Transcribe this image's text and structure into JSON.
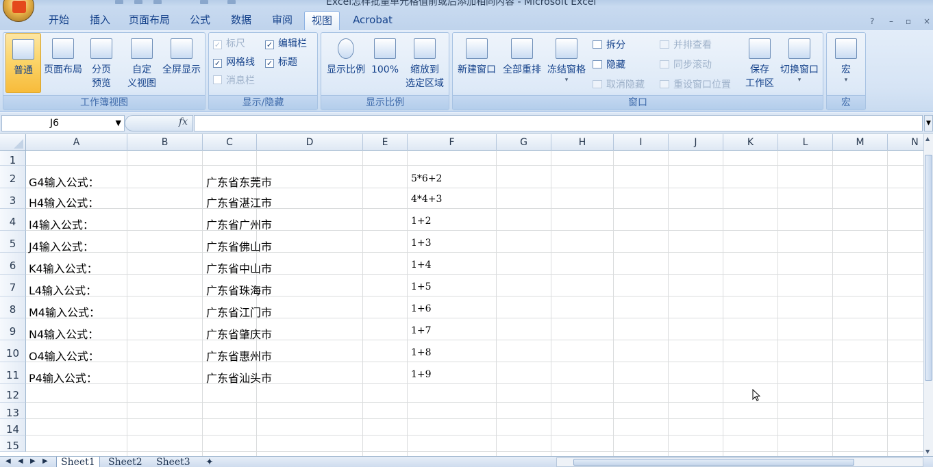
{
  "window": {
    "title": "Excel怎样批量单元格值前或后添加相同内容 - Microsoft Excel"
  },
  "tabs": [
    "开始",
    "插入",
    "页面布局",
    "公式",
    "数据",
    "审阅",
    "视图",
    "Acrobat"
  ],
  "active_tab": "视图",
  "ribbon": {
    "workbook_views": {
      "label": "工作簿视图",
      "normal": "普通",
      "page_layout": "页面布局",
      "page_break_1": "分页",
      "page_break_2": "预览",
      "custom_1": "自定",
      "custom_2": "义视图",
      "fullscreen": "全屏显示"
    },
    "show_hide": {
      "label": "显示/隐藏",
      "ruler": "标尺",
      "formula_bar": "编辑栏",
      "gridlines": "网格线",
      "headings": "标题",
      "message_bar": "消息栏"
    },
    "zoom": {
      "label": "显示比例",
      "zoom": "显示比例",
      "hundred": "100%",
      "zoom_sel_1": "缩放到",
      "zoom_sel_2": "选定区域"
    },
    "window": {
      "label": "窗口",
      "new_window": "新建窗口",
      "arrange_all": "全部重排",
      "freeze": "冻结窗格",
      "split": "拆分",
      "hide": "隐藏",
      "unhide": "取消隐藏",
      "side_by_side": "并排查看",
      "sync_scroll": "同步滚动",
      "reset_pos": "重设窗口位置",
      "save_ws_1": "保存",
      "save_ws_2": "工作区",
      "switch": "切换窗口"
    },
    "macros": {
      "label": "宏",
      "macro": "宏"
    }
  },
  "formula_bar": {
    "name_box": "J6",
    "fx": "fx",
    "content": ""
  },
  "columns": [
    "A",
    "B",
    "C",
    "D",
    "E",
    "F",
    "G",
    "H",
    "I",
    "J",
    "K",
    "L",
    "M",
    "N"
  ],
  "rows": [
    "1",
    "2",
    "3",
    "4",
    "5",
    "6",
    "7",
    "8",
    "9",
    "10",
    "11",
    "12",
    "13",
    "14",
    "15"
  ],
  "cells": {
    "A": [
      "G4输入公式：",
      "H4输入公式：",
      "I4输入公式：",
      "J4输入公式：",
      "K4输入公式：",
      "L4输入公式：",
      "M4输入公式：",
      "N4输入公式：",
      "O4输入公式：",
      "P4输入公式："
    ],
    "C": [
      "广东省东莞市",
      "广东省湛江市",
      "广东省广州市",
      "广东省佛山市",
      "广东省中山市",
      "广东省珠海市",
      "广东省江门市",
      "广东省肇庆市",
      "广东省惠州市",
      "广东省汕头市"
    ],
    "F": [
      "5*6+2",
      "4*4+3",
      "1+2",
      "1+3",
      "1+4",
      "1+5",
      "1+6",
      "1+7",
      "1+8",
      "1+9"
    ]
  },
  "sheets": [
    "Sheet1",
    "Sheet2",
    "Sheet3"
  ],
  "active_sheet": "Sheet1",
  "colors": {
    "ribbon_bg": "#dbe7f6",
    "tab_text": "#15428b",
    "selected_button": "#fbd56b",
    "gridline": "#dadcdd"
  }
}
